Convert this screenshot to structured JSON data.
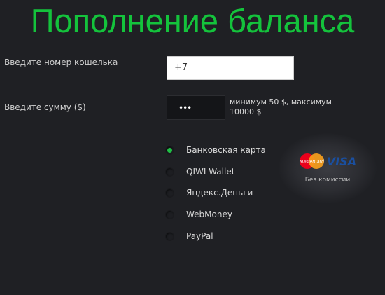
{
  "page": {
    "title": "Пополнение баланса"
  },
  "form": {
    "wallet_label": "Введите номер кошелька",
    "wallet_value": "+7",
    "amount_label": "Введите сумму ($)",
    "amount_value_masked": "•••",
    "amount_hint": "минимум 50 $, максимум 10000 $"
  },
  "payment_methods": [
    {
      "label": "Банковская карта",
      "selected": true
    },
    {
      "label": "QIWI Wallet",
      "selected": false
    },
    {
      "label": "Яндекс.Деньги",
      "selected": false
    },
    {
      "label": "WebMoney",
      "selected": false
    },
    {
      "label": "PayPal",
      "selected": false
    }
  ],
  "payment_info": {
    "logo_mastercard": "MasterCard",
    "logo_visa": "VISA",
    "commission_text": "Без комиссии"
  },
  "colors": {
    "background": "#1f2024",
    "title_green": "#14c33c",
    "radio_selected": "#1fbf45",
    "visa_blue": "#1a4fa0",
    "mastercard_red": "#eb001b",
    "mastercard_orange": "#f79e1b"
  },
  "icons": [
    "mastercard-logo-icon",
    "visa-logo-icon",
    "radio-icon"
  ]
}
